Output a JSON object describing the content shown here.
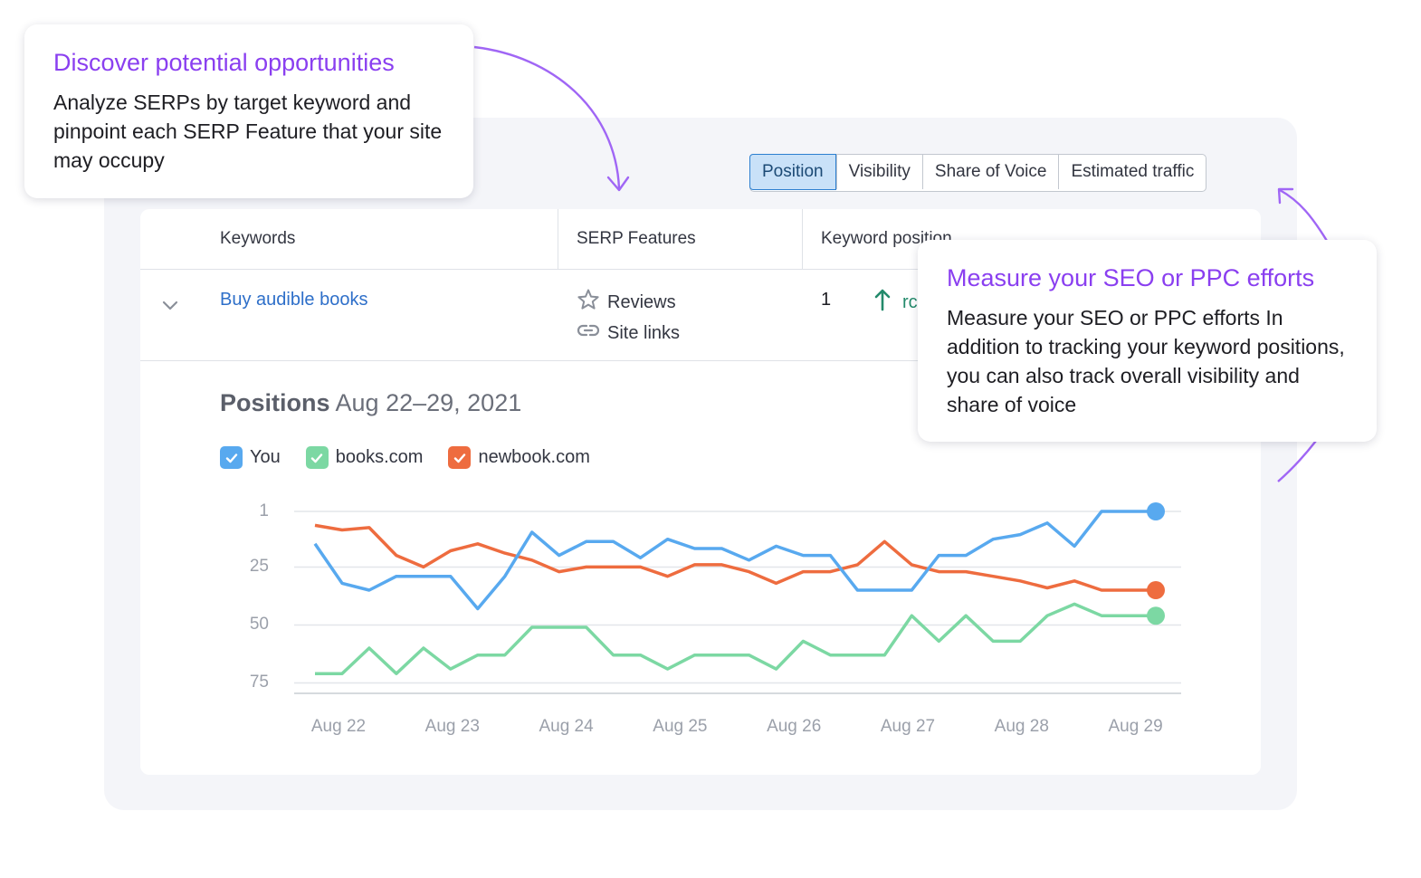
{
  "tabs": [
    {
      "label": "Position",
      "active": true
    },
    {
      "label": "Visibility",
      "active": false
    },
    {
      "label": "Share of Voice",
      "active": false
    },
    {
      "label": "Estimated traffic",
      "active": false
    }
  ],
  "table": {
    "headers": [
      "Keywords",
      "SERP Features",
      "Keyword position"
    ],
    "row": {
      "keyword": "Buy audible books",
      "features": [
        {
          "icon": "star-icon",
          "label": "Reviews"
        },
        {
          "icon": "link-icon",
          "label": "Site links"
        }
      ],
      "position": "1",
      "trend_text": "rc"
    }
  },
  "chart_heading": {
    "bold": "Positions",
    "range": "Aug 22–29, 2021"
  },
  "chart_data": {
    "type": "line",
    "title": "Positions Aug 22–29, 2021",
    "xlabel": "",
    "ylabel": "",
    "y_inverted": true,
    "ylim": [
      1,
      75
    ],
    "yticks": [
      "1",
      "25",
      "50",
      "75"
    ],
    "x_labels": [
      "Aug 22",
      "Aug 23",
      "Aug 24",
      "Aug 25",
      "Aug 26",
      "Aug 27",
      "Aug 28",
      "Aug 29"
    ],
    "grid": true,
    "legend_position": "top-left",
    "series": [
      {
        "name": "You",
        "color": "#58a9ef",
        "values": [
          15,
          32,
          35,
          29,
          29,
          29,
          43,
          29,
          10,
          20,
          14,
          14,
          21,
          13,
          17,
          17,
          22,
          16,
          20,
          20,
          35,
          35,
          35,
          20,
          20,
          13,
          11,
          6,
          16,
          1,
          1,
          1
        ]
      },
      {
        "name": "books.com",
        "color": "#7cd8a3",
        "values": [
          71,
          71,
          60,
          71,
          60,
          69,
          63,
          63,
          51,
          51,
          51,
          63,
          63,
          69,
          63,
          63,
          63,
          69,
          57,
          63,
          63,
          63,
          46,
          57,
          46,
          57,
          57,
          46,
          41,
          46,
          46,
          46
        ]
      },
      {
        "name": "newbook.com",
        "color": "#ee6c3f",
        "values": [
          7,
          9,
          8,
          20,
          25,
          18,
          15,
          19,
          22,
          27,
          25,
          25,
          25,
          29,
          24,
          24,
          27,
          32,
          27,
          27,
          24,
          14,
          24,
          27,
          27,
          29,
          31,
          34,
          31,
          35,
          35,
          35
        ]
      }
    ]
  },
  "callouts": {
    "left": {
      "title": "Discover potential opportunities",
      "body": "Analyze SERPs by target keyword and pinpoint each SERP Feature that your site may occupy"
    },
    "right": {
      "title": "Measure your SEO or PPC efforts",
      "body": "Measure your SEO or PPC efforts In addition to tracking your keyword positions, you can also track overall visibility and share of voice"
    }
  },
  "colors": {
    "accent": "#8a3ff0",
    "link": "#2e6fc9",
    "active_tab_bg": "#c9e1f8"
  }
}
